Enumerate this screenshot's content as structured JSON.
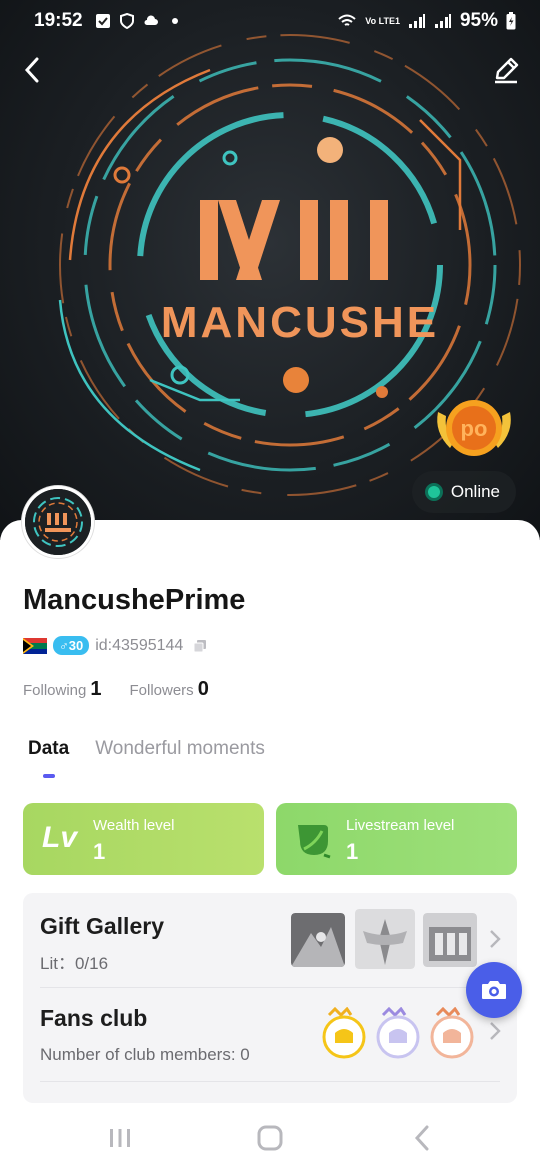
{
  "status_bar": {
    "time": "19:52",
    "network_label": "Vo LTE1",
    "battery": "95%"
  },
  "banner": {
    "art_title": "MANCUSHE",
    "art_monogram": "MII",
    "badge_text": "po",
    "online_label": "Online",
    "online_color": "#1fc49a"
  },
  "profile": {
    "name": "MancushePrime",
    "country_flag": "south-africa-flag",
    "gender_age": "♂30",
    "id_text": "id:43595144",
    "following_label": "Following",
    "following_count": "1",
    "followers_label": "Followers",
    "followers_count": "0"
  },
  "tabs": [
    {
      "label": "Data",
      "active": true
    },
    {
      "label": "Wonderful moments",
      "active": false
    }
  ],
  "levels": {
    "wealth": {
      "icon_text": "Lv",
      "label": "Wealth level",
      "value": "1"
    },
    "livestream": {
      "label": "Livestream level",
      "value": "1"
    }
  },
  "gift_gallery": {
    "title": "Gift Gallery",
    "lit": "Lit：0/16"
  },
  "fans_club": {
    "title": "Fans club",
    "members": "Number of club members: 0"
  },
  "colors": {
    "accent": "#4a5ee8",
    "wealth": "#a7d761",
    "livestream": "#8dd86a"
  }
}
